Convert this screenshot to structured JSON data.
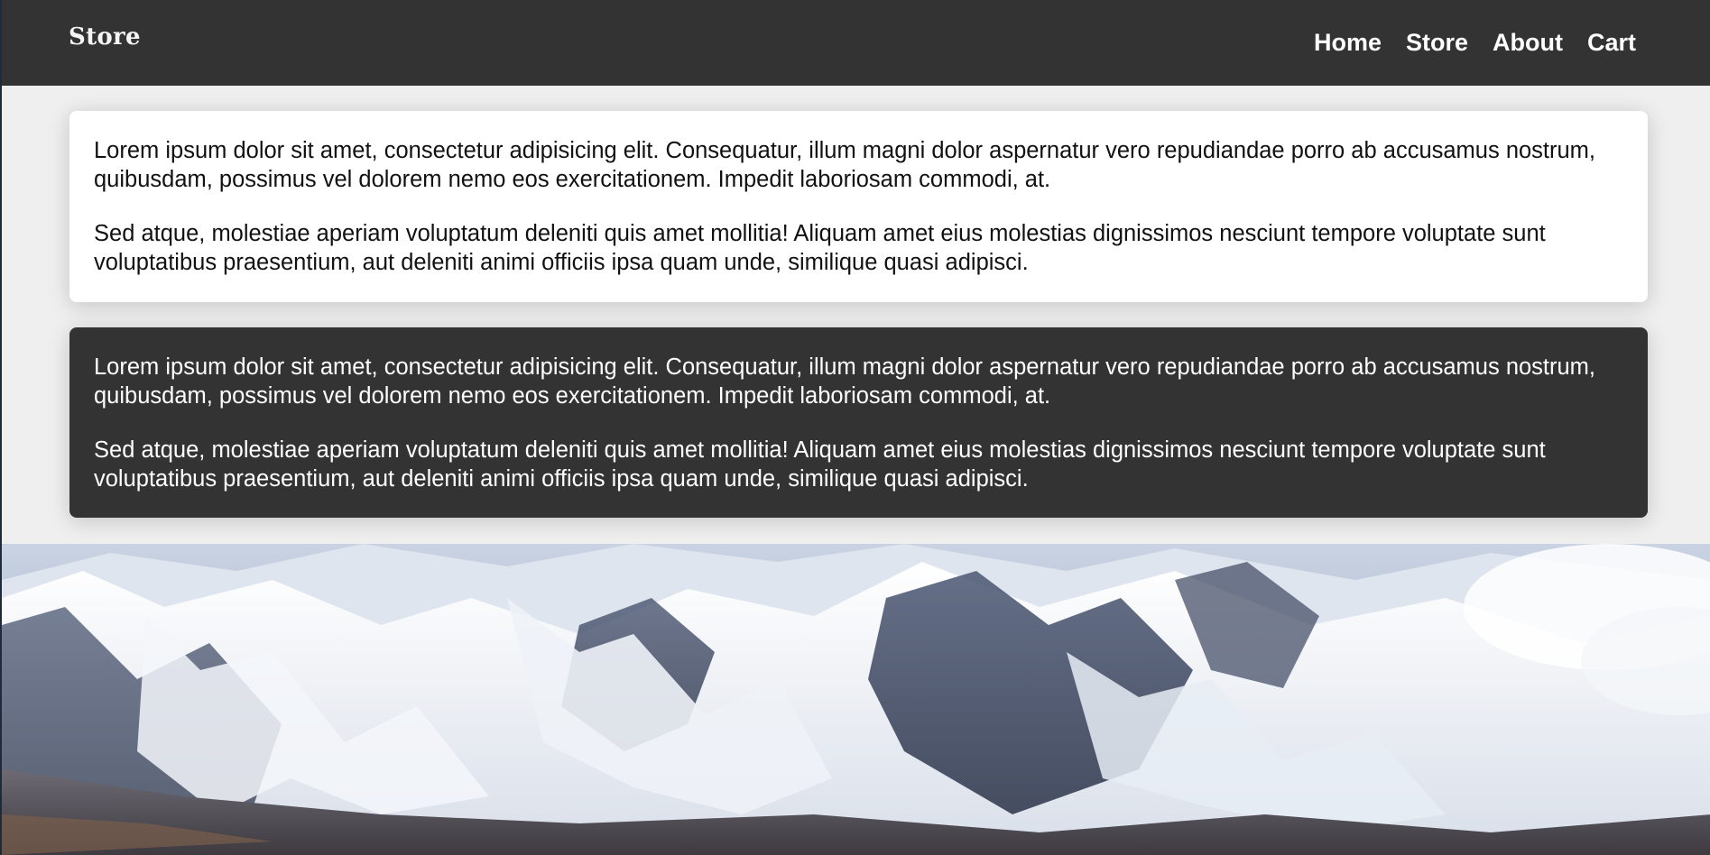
{
  "header": {
    "brand": "Store",
    "nav": [
      {
        "label": "Home"
      },
      {
        "label": "Store"
      },
      {
        "label": "About"
      },
      {
        "label": "Cart"
      }
    ]
  },
  "cards": [
    {
      "theme": "light",
      "paragraphs": [
        "Lorem ipsum dolor sit amet, consectetur adipisicing elit. Consequatur, illum magni dolor aspernatur vero repudiandae porro ab accusamus nostrum, quibusdam, possimus vel dolorem nemo eos exercitationem. Impedit laboriosam commodi, at.",
        "Sed atque, molestiae aperiam voluptatum deleniti quis amet mollitia! Aliquam amet eius molestias dignissimos nesciunt tempore voluptate sunt voluptatibus praesentium, aut deleniti animi officiis ipsa quam unde, similique quasi adipisci."
      ]
    },
    {
      "theme": "dark",
      "paragraphs": [
        "Lorem ipsum dolor sit amet, consectetur adipisicing elit. Consequatur, illum magni dolor aspernatur vero repudiandae porro ab accusamus nostrum, quibusdam, possimus vel dolorem nemo eos exercitationem. Impedit laboriosam commodi, at.",
        "Sed atque, molestiae aperiam voluptatum deleniti quis amet mollitia! Aliquam amet eius molestias dignissimos nesciunt tempore voluptate sunt voluptatibus praesentium, aut deleniti animi officiis ipsa quam unde, similique quasi adipisci."
      ]
    }
  ],
  "colors": {
    "navbar": "#333333",
    "page_bg": "#efefef",
    "card_light": "#ffffff",
    "card_dark": "#333333"
  }
}
